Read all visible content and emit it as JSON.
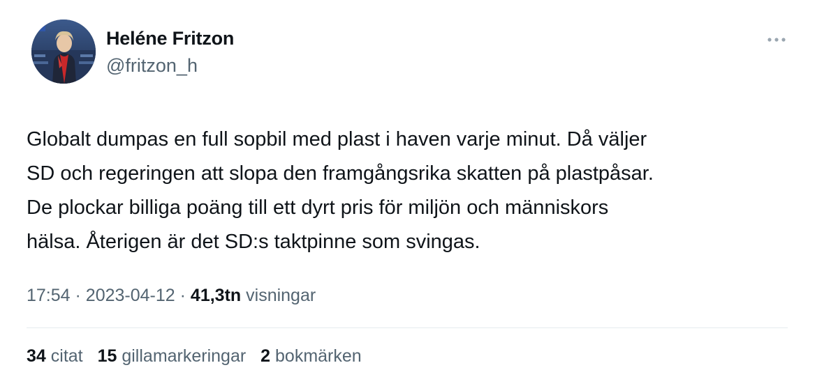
{
  "author": {
    "name": "Heléne Fritzon",
    "handle": "@fritzon_h"
  },
  "tweet": {
    "text": "Globalt dumpas en full sopbil med plast i haven varje minut. Då väljer\nSD och regeringen att slopa den framgångsrika skatten på plastpåsar.\nDe plockar billiga poäng till ett dyrt pris för miljön och människors\nhälsa. Återigen är det SD:s taktpinne som svingas."
  },
  "meta": {
    "time": "17:54",
    "separator": "·",
    "date": "2023-04-12",
    "views_count": "41,3tn",
    "views_label": "visningar"
  },
  "stats": [
    {
      "count": "34",
      "label": "citat"
    },
    {
      "count": "15",
      "label": "gillamarkeringar"
    },
    {
      "count": "2",
      "label": "bokmärken"
    }
  ],
  "icons": {
    "more": "more-horizontal-icon"
  },
  "colors": {
    "text_primary": "#0f1419",
    "text_secondary": "#536471",
    "divider": "#e6ebef"
  }
}
